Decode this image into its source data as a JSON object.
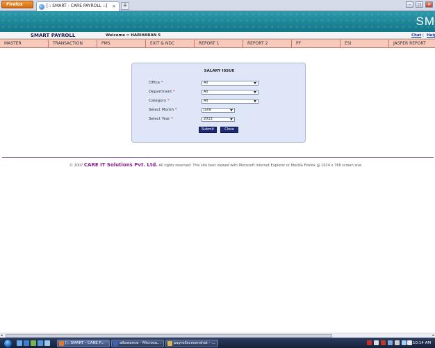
{
  "browser": {
    "menu_button_label": "Firefox",
    "tab_title": "[:: SMART - CARE PAYROLL ::]",
    "new_tab_label": "+",
    "tab_close_label": "×",
    "win_minimize": "–",
    "win_restore": "□",
    "win_close": "✕"
  },
  "banner": {
    "logo_text": "SM"
  },
  "header": {
    "app_title": "SMART PAYROLL",
    "welcome_text": "Welcome :: HARIHARAN S",
    "chat_link": "Chat",
    "separator": "|",
    "help_link": "Help"
  },
  "menu": {
    "items": [
      {
        "label": "MASTER"
      },
      {
        "label": "TRANSACTION"
      },
      {
        "label": "PMS"
      },
      {
        "label": "EXIT & NDC"
      },
      {
        "label": "REPORT 1"
      },
      {
        "label": "REPORT 2"
      },
      {
        "label": "PF"
      },
      {
        "label": "ESI"
      },
      {
        "label": "JASPER REPORT"
      }
    ]
  },
  "form": {
    "title": "SALARY ISSUE",
    "required_mark": "*",
    "fields": {
      "office": {
        "label": "Office",
        "value": "All"
      },
      "department": {
        "label": "Department",
        "value": "All"
      },
      "category": {
        "label": "Category",
        "value": "All"
      },
      "month": {
        "label": "Select Month",
        "value": "June"
      },
      "year": {
        "label": "Select Year",
        "value": "2013"
      }
    },
    "submit_label": "Submit",
    "close_label": "Close"
  },
  "footer": {
    "copyright": "© 2007",
    "company": "CARE IT Solutions Pvt. Ltd.",
    "note": "All rights reserved.   This site best viewed with Microsoft Internet Explorer or Mozilla Firefox @ 1024 x 768 screen size."
  },
  "scrollbar": {
    "left_arrow": "◂",
    "right_arrow": "▸"
  },
  "taskbar": {
    "buttons": [
      {
        "label": "[:: SMART - CARE P..."
      },
      {
        "label": "allowance - Microso..."
      },
      {
        "label": "payrollscreenshot - ..."
      }
    ],
    "clock": "10:14 AM"
  },
  "colors": {
    "banner": "#1b8495",
    "menubar": "#f7c9bc",
    "panel": "#dfe6f7",
    "button": "#1e2a74",
    "brand": "#8b1e8b"
  }
}
